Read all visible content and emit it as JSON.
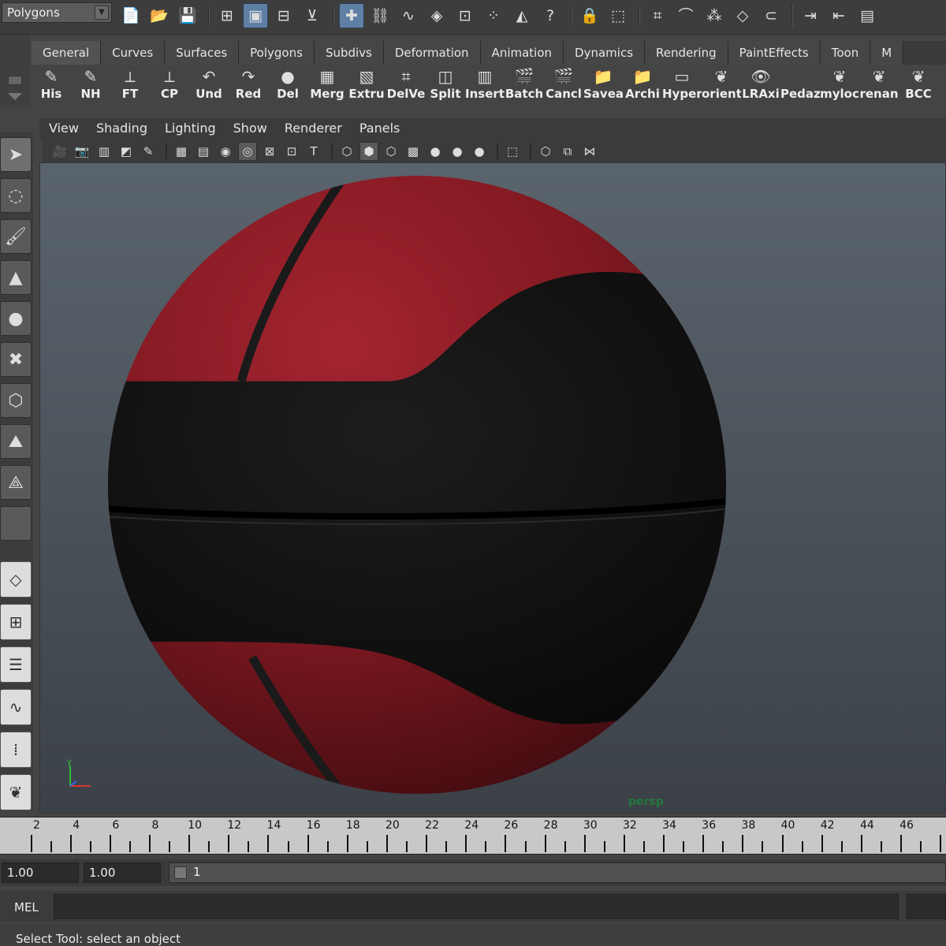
{
  "colors": {
    "selected_tool": "#5f7fa5",
    "ball_red": "#8a1b22",
    "ball_black": "#151515",
    "camera_label": "#24773a"
  },
  "top": {
    "mode": "Polygons",
    "icons": [
      {
        "name": "new-scene-icon",
        "glyph": "📄"
      },
      {
        "name": "open-scene-icon",
        "glyph": "📂"
      },
      {
        "name": "save-scene-icon",
        "glyph": "💾"
      },
      {
        "name": "select-by-hierarchy-icon",
        "glyph": "⊞"
      },
      {
        "name": "select-by-object-type-icon",
        "glyph": "▣"
      },
      {
        "name": "select-by-component-type-icon",
        "glyph": "⊟"
      },
      {
        "name": "lock-selection-icon",
        "glyph": "⊻"
      },
      {
        "name": "select-handles-icon",
        "glyph": "✚"
      },
      {
        "name": "select-joints-icon",
        "glyph": "⛓"
      },
      {
        "name": "select-curves-icon",
        "glyph": "∿"
      },
      {
        "name": "select-surfaces-icon",
        "glyph": "◈"
      },
      {
        "name": "select-deformations-icon",
        "glyph": "⊡"
      },
      {
        "name": "select-dynamics-icon",
        "glyph": "⁘"
      },
      {
        "name": "select-rendering-icon",
        "glyph": "◭"
      },
      {
        "name": "select-misc-icon",
        "glyph": "?"
      },
      {
        "name": "lock-icon",
        "glyph": "🔒"
      },
      {
        "name": "highlight-selection-icon",
        "glyph": "⬚"
      },
      {
        "name": "snap-to-grids-icon",
        "glyph": "⌗"
      },
      {
        "name": "snap-to-curves-icon",
        "glyph": "⌒"
      },
      {
        "name": "snap-to-points-icon",
        "glyph": "⁂"
      },
      {
        "name": "snap-to-view-planes-icon",
        "glyph": "◇"
      },
      {
        "name": "make-live-icon",
        "glyph": "⊂"
      },
      {
        "name": "input-operations-icon",
        "glyph": "⇥"
      },
      {
        "name": "output-operations-icon",
        "glyph": "⇤"
      },
      {
        "name": "construction-history-icon",
        "glyph": "▤"
      }
    ]
  },
  "shelf": {
    "tabs": [
      "General",
      "Curves",
      "Surfaces",
      "Polygons",
      "Subdivs",
      "Deformation",
      "Animation",
      "Dynamics",
      "Rendering",
      "PaintEffects",
      "Toon",
      "M"
    ],
    "buttons": [
      {
        "label": "His",
        "name": "history-shelf-icon",
        "glyph": "✎"
      },
      {
        "label": "NH",
        "name": "no-history-shelf-icon",
        "glyph": "✎"
      },
      {
        "label": "FT",
        "name": "freeze-transform-shelf-icon",
        "glyph": "⟂"
      },
      {
        "label": "CP",
        "name": "center-pivot-shelf-icon",
        "glyph": "⟂"
      },
      {
        "label": "Und",
        "name": "undo-shelf-icon",
        "glyph": "↶"
      },
      {
        "label": "Red",
        "name": "redo-shelf-icon",
        "glyph": "↷"
      },
      {
        "label": "Del",
        "name": "delete-shelf-icon",
        "glyph": "●"
      },
      {
        "label": "Merg",
        "name": "merge-shelf-icon",
        "glyph": "▦"
      },
      {
        "label": "Extru",
        "name": "extrude-shelf-icon",
        "glyph": "▧"
      },
      {
        "label": "DelVe",
        "name": "delete-vertex-shelf-icon",
        "glyph": "⌗"
      },
      {
        "label": "Split",
        "name": "split-shelf-icon",
        "glyph": "◫"
      },
      {
        "label": "Insert",
        "name": "insert-edge-loop-shelf-icon",
        "glyph": "▥"
      },
      {
        "label": "Batch",
        "name": "batch-render-shelf-icon",
        "glyph": "🎬"
      },
      {
        "label": "Cancl",
        "name": "cancel-batch-shelf-icon",
        "glyph": "🎬"
      },
      {
        "label": "Saveas",
        "name": "save-as-shelf-icon",
        "glyph": "📁"
      },
      {
        "label": "Archi",
        "name": "archive-shelf-icon",
        "glyph": "📁"
      },
      {
        "label": "Hyper",
        "name": "hypershade-shelf-icon",
        "glyph": "▭"
      },
      {
        "label": "orient",
        "name": "orient-shelf-icon",
        "glyph": "❦"
      },
      {
        "label": "LRAxi",
        "name": "local-rotation-axis-shelf-icon",
        "glyph": "👁"
      },
      {
        "label": "Pedaz",
        "name": "pedaz-shelf-icon",
        "glyph": " "
      },
      {
        "label": "myloc",
        "name": "myloc-shelf-icon",
        "glyph": "❦"
      },
      {
        "label": "renan",
        "name": "rename-shelf-icon",
        "glyph": "❦"
      },
      {
        "label": "BCC",
        "name": "bcc-shelf-icon",
        "glyph": "❦"
      }
    ]
  },
  "tools": [
    {
      "name": "select-tool-icon",
      "glyph": "➤",
      "active": true
    },
    {
      "name": "lasso-tool-icon",
      "glyph": "◌"
    },
    {
      "name": "paint-select-tool-icon",
      "glyph": "🖌"
    },
    {
      "name": "move-tool-icon",
      "glyph": "▲"
    },
    {
      "name": "rotate-tool-icon",
      "glyph": "●"
    },
    {
      "name": "scale-tool-icon",
      "glyph": "✖"
    },
    {
      "name": "universal-manipulator-icon",
      "glyph": "⬡"
    },
    {
      "name": "soft-modification-tool-icon",
      "glyph": "⛰"
    },
    {
      "name": "show-manipulator-icon",
      "glyph": "⟁"
    },
    {
      "name": "last-tool-slot-icon",
      "glyph": " "
    }
  ],
  "layouts": [
    {
      "name": "single-perspective-layout-icon",
      "glyph": "◇"
    },
    {
      "name": "four-view-layout-icon",
      "glyph": "⊞"
    },
    {
      "name": "outliner-perspective-layout-icon",
      "glyph": "☰"
    },
    {
      "name": "persp-graph-layout-icon",
      "glyph": "∿"
    },
    {
      "name": "hypershade-persp-layout-icon",
      "glyph": "⁞"
    },
    {
      "name": "custom-layout-icon",
      "glyph": "❦"
    }
  ],
  "viewport": {
    "menu": [
      "View",
      "Shading",
      "Lighting",
      "Show",
      "Renderer",
      "Panels"
    ],
    "camera": "persp",
    "axis_y": "y",
    "tools": [
      {
        "name": "camera-attributes-icon",
        "glyph": "🎥"
      },
      {
        "name": "camera-bookmarks-icon",
        "glyph": "📷"
      },
      {
        "name": "image-plane-icon",
        "glyph": "▥"
      },
      {
        "name": "two-d-pan-zoom-icon",
        "glyph": "◩"
      },
      {
        "name": "grease-pencil-icon",
        "glyph": "✎"
      },
      {
        "sep": true
      },
      {
        "name": "grid-icon",
        "glyph": "▦"
      },
      {
        "name": "film-gate-icon",
        "glyph": "▤"
      },
      {
        "name": "resolution-gate-icon",
        "glyph": "◉"
      },
      {
        "name": "gate-mask-icon",
        "glyph": "◎",
        "box": true
      },
      {
        "name": "field-chart-icon",
        "glyph": "⊠"
      },
      {
        "name": "safe-action-icon",
        "glyph": "⊡"
      },
      {
        "name": "safe-title-icon",
        "glyph": "T"
      },
      {
        "sep": true
      },
      {
        "name": "wireframe-icon",
        "glyph": "⬡"
      },
      {
        "name": "smooth-shade-icon",
        "glyph": "⬢",
        "box": true
      },
      {
        "name": "wireframe-on-shaded-icon",
        "glyph": "⬡"
      },
      {
        "name": "textured-icon",
        "glyph": "▩"
      },
      {
        "name": "use-all-lights-icon",
        "glyph": "●"
      },
      {
        "name": "shadows-icon",
        "glyph": "●"
      },
      {
        "name": "high-quality-icon",
        "glyph": "●"
      },
      {
        "sep": true
      },
      {
        "name": "isolate-select-icon",
        "glyph": "⬚"
      },
      {
        "sep": true
      },
      {
        "name": "xray-icon",
        "glyph": "⬡"
      },
      {
        "name": "xray-joints-icon",
        "glyph": "⧉"
      },
      {
        "name": "xray-active-components-icon",
        "glyph": "⋈"
      }
    ]
  },
  "timeline": {
    "labels": [
      "2",
      "4",
      "6",
      "8",
      "10",
      "12",
      "14",
      "16",
      "18",
      "20",
      "22",
      "24",
      "26",
      "28",
      "30",
      "32",
      "34",
      "36",
      "38",
      "40",
      "42",
      "44",
      "46"
    ]
  },
  "range": {
    "start": "1.00",
    "current": "1.00",
    "slider_value": "1"
  },
  "command": {
    "label": "MEL",
    "value": ""
  },
  "help_line": "Select Tool: select an object"
}
